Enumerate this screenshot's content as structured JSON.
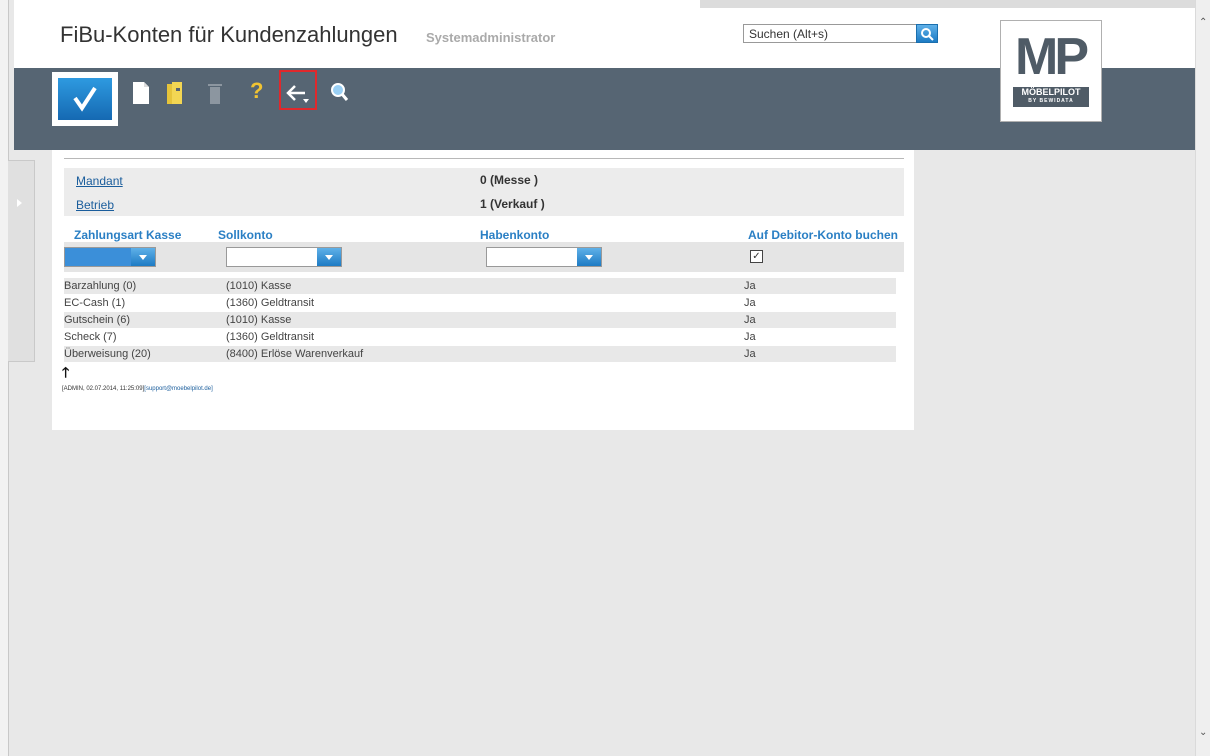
{
  "header": {
    "title": "FiBu-Konten für Kundenzahlungen",
    "subtitle": "Systemadministrator",
    "search_placeholder": "Suchen (Alt+s)"
  },
  "logo": {
    "text": "MP",
    "brand": "MÖBELPILOT",
    "tagline": "BY BEWIDATA"
  },
  "toolbar": {
    "icons": [
      "checkmark-icon",
      "new-document-icon",
      "open-folder-icon",
      "delete-icon",
      "help-icon",
      "back-icon",
      "search-zoom-icon"
    ],
    "help_label": "?"
  },
  "info": {
    "mandant_label": "Mandant",
    "mandant_value": "0 (Messe )",
    "betrieb_label": "Betrieb",
    "betrieb_value": "1 (Verkauf )"
  },
  "columns": {
    "zahlungsart": "Zahlungsart Kasse",
    "sollkonto": "Sollkonto",
    "habenkonto": "Habenkonto",
    "debitor": "Auf Debitor-Konto buchen"
  },
  "filters": {
    "debitor_checked": "✓"
  },
  "rows": [
    {
      "zahlungsart": "Barzahlung (0)",
      "sollkonto": "(1010) Kasse",
      "habenkonto": "",
      "debitor": "Ja"
    },
    {
      "zahlungsart": "EC-Cash (1)",
      "sollkonto": "(1360) Geldtransit",
      "habenkonto": "",
      "debitor": "Ja"
    },
    {
      "zahlungsart": "Gutschein (6)",
      "sollkonto": "(1010) Kasse",
      "habenkonto": "",
      "debitor": "Ja"
    },
    {
      "zahlungsart": "Scheck (7)",
      "sollkonto": "(1360) Geldtransit",
      "habenkonto": "",
      "debitor": "Ja"
    },
    {
      "zahlungsart": "Überweisung (20)",
      "sollkonto": "(8400) Erlöse Warenverkauf",
      "habenkonto": "",
      "debitor": "Ja"
    }
  ],
  "footer": {
    "arrow": "🡑",
    "info": "[ADMIN, 02.07.2014, 11:25:09]",
    "email": "[support@moebelpilot.de]"
  },
  "colors": {
    "toolbar": "#566573",
    "accent": "#2a7fc4",
    "highlight": "#e0282c"
  }
}
